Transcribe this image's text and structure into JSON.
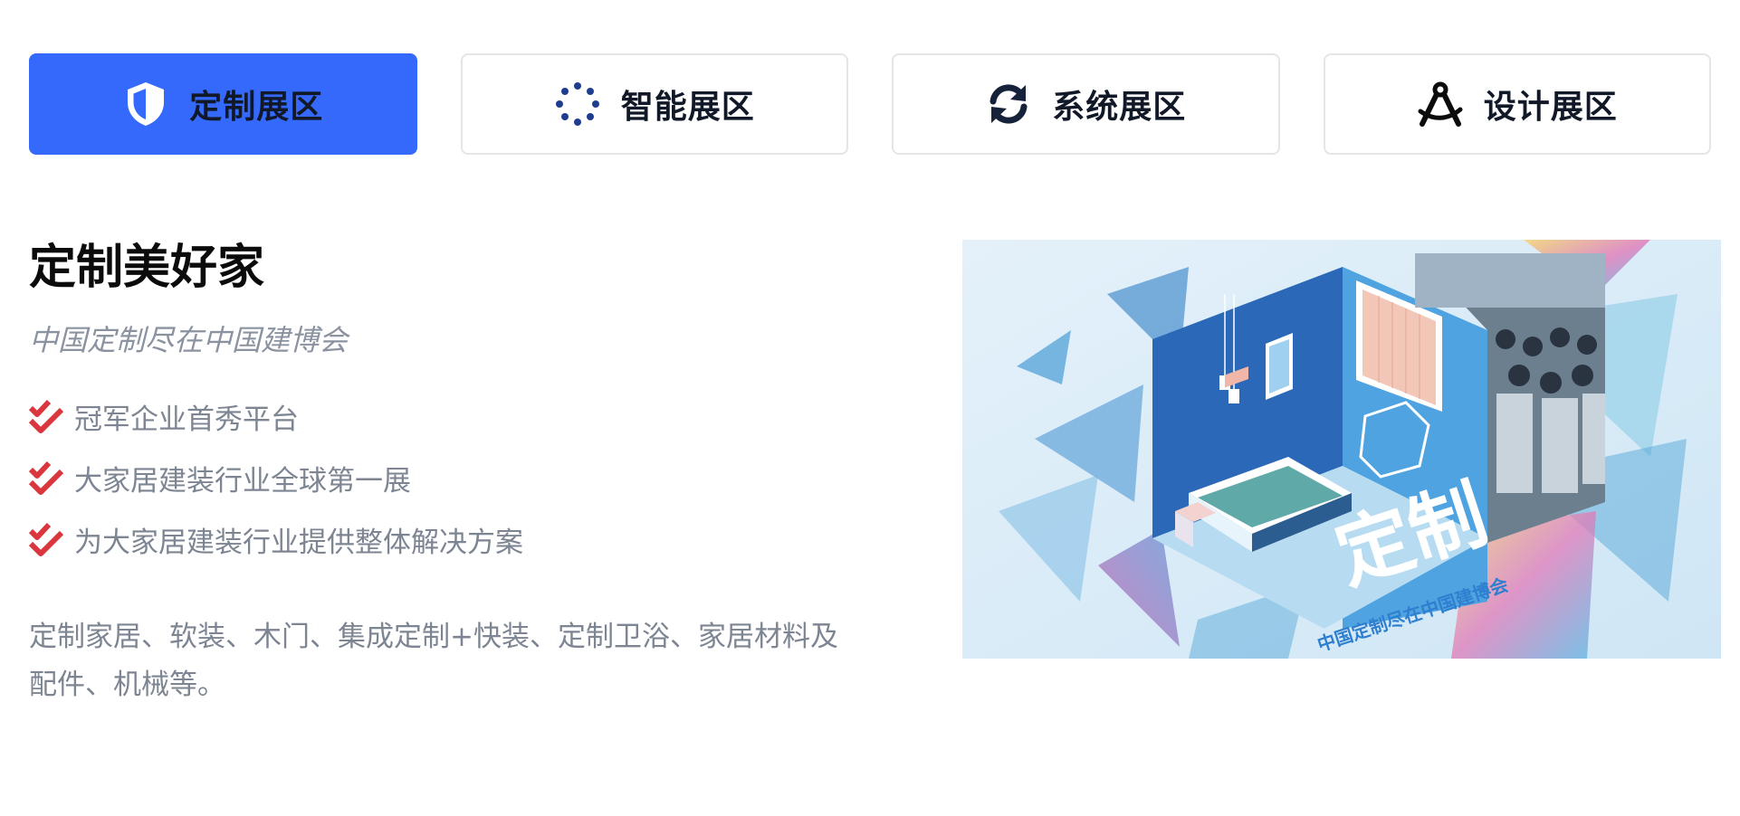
{
  "tabs": [
    {
      "label": "定制展区",
      "icon": "shield-icon",
      "active": true
    },
    {
      "label": "智能展区",
      "icon": "spinner-icon",
      "active": false
    },
    {
      "label": "系统展区",
      "icon": "sync-icon",
      "active": false
    },
    {
      "label": "设计展区",
      "icon": "compass-drafting-icon",
      "active": false
    }
  ],
  "section": {
    "title": "定制美好家",
    "subtitle": "中国定制尽在中国建博会",
    "features": [
      "冠军企业首秀平台",
      "大家居建装行业全球第一展",
      "为大家居建装行业提供整体解决方案"
    ],
    "description": "定制家居、软装、木门、集成定制+快装、定制卫浴、家居材料及配件、机械等。"
  },
  "hero_image": {
    "headline": "定制",
    "tagline": "中国定制尽在中国建博会"
  },
  "colors": {
    "accent": "#3469fb",
    "check": "#d9363e",
    "muted_text": "#7d8592",
    "dark_text": "#111827"
  }
}
